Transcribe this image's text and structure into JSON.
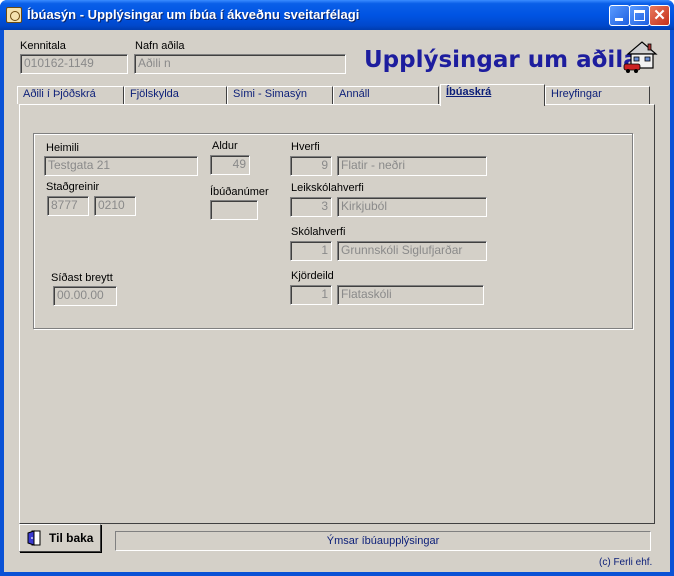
{
  "window": {
    "title": "Íbúasýn - Upplýsingar um íbúa í ákveðnu sveitarfélagi"
  },
  "header": {
    "kennitala_label": "Kennitala",
    "kennitala_value": "010162-1149",
    "nafn_label": "Nafn aðila",
    "nafn_value": "Aðili n",
    "big_title": "Upplýsingar um aðila"
  },
  "tabs": [
    {
      "label": "Aðili í Þjóðskrá"
    },
    {
      "label": "Fjölskylda"
    },
    {
      "label": "Sími - Simasýn"
    },
    {
      "label": "Annáll"
    },
    {
      "label": "Íbúaskrá",
      "active": true
    },
    {
      "label": "Hreyfingar"
    }
  ],
  "form": {
    "heimili_label": "Heimili",
    "heimili_value": "Testgata 21",
    "stadgreinir_label": "Staðgreinir",
    "stadgreinir_1": "8777",
    "stadgreinir_2": "0210",
    "sidast_label": "Síðast breytt",
    "sidast_value": "00.00.00",
    "aldur_label": "Aldur",
    "aldur_value": "49",
    "ibuanumer_label": "Íbúðanúmer",
    "ibuanumer_value": "",
    "hverfi_label": "Hverfi",
    "hverfi_num": "9",
    "hverfi_name": "Flatir - neðri",
    "leikskola_label": "Leikskólahverfi",
    "leikskola_num": "3",
    "leikskola_name": "Kirkjuból",
    "skola_label": "Skólahverfi",
    "skola_num": "1",
    "skola_name": "Grunnskóli Siglufjarðar",
    "kjordeild_label": "Kjördeild",
    "kjordeild_num": "1",
    "kjordeild_name": "Flataskóli"
  },
  "footer": {
    "back_label": "Til baka",
    "status_text": "Ýmsar íbúaupplýsingar",
    "copyright": "(c) Ferli ehf."
  },
  "icons": {
    "app": "app-icon",
    "logo": "house-car-icon",
    "back": "exit-door-icon"
  }
}
